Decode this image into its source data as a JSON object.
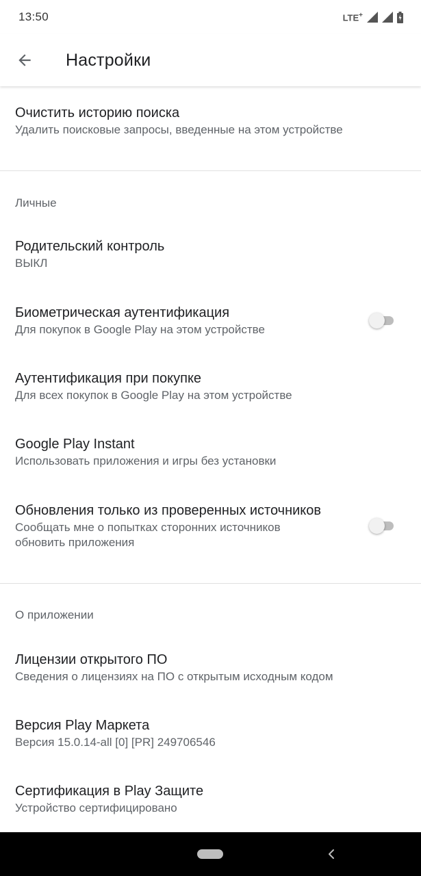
{
  "status_bar": {
    "time": "13:50",
    "network": "LTE",
    "network_plus": "+",
    "icons": [
      "signal-icon",
      "signal-icon",
      "battery-icon"
    ]
  },
  "app_bar": {
    "title": "Настройки",
    "back_icon": "arrow-back-icon"
  },
  "general": {
    "clear_history": {
      "title": "Очистить историю поиска",
      "subtitle": "Удалить поисковые запросы, введенные на этом устройстве"
    }
  },
  "personal": {
    "header": "Личные",
    "parental_control": {
      "title": "Родительский контроль",
      "subtitle": "ВЫКЛ"
    },
    "biometric_auth": {
      "title": "Биометрическая аутентификация",
      "subtitle": "Для покупок в Google Play на этом устройстве",
      "toggle_on": false
    },
    "purchase_auth": {
      "title": "Аутентификация при покупке",
      "subtitle": "Для всех покупок в Google Play на этом устройстве"
    },
    "instant": {
      "title": "Google Play Instant",
      "subtitle": "Использовать приложения и игры без установки"
    },
    "verified_updates": {
      "title": "Обновления только из проверенных источников",
      "subtitle_line1": "Сообщать мне о попытках сторонних источников",
      "subtitle_line2": "обновить приложения",
      "toggle_on": false
    }
  },
  "about": {
    "header": "О приложении",
    "licenses": {
      "title": "Лицензии открытого ПО",
      "subtitle": "Сведения о лицензиях на ПО с открытым исходным кодом"
    },
    "version": {
      "title": "Версия Play Маркета",
      "subtitle": "Версия 15.0.14-all [0] [PR] 249706546"
    },
    "certification": {
      "title": "Сертификация в Play Защите",
      "subtitle": "Устройство сертифицировано"
    }
  },
  "colors": {
    "text_primary": "#202124",
    "text_secondary": "#5f6368",
    "divider": "#e0e0e0",
    "switch_off_track": "#bdbdbd",
    "switch_off_thumb": "#f1f1f1"
  }
}
